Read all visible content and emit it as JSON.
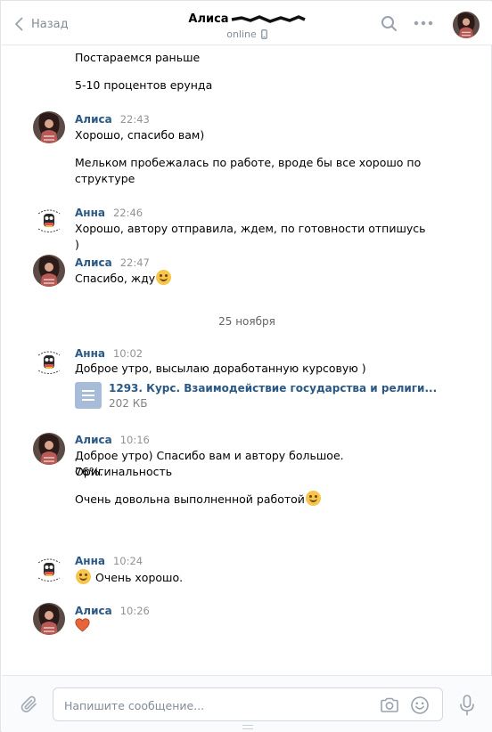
{
  "header": {
    "back_label": "Назад",
    "peer_name": "Алиса",
    "peer_status": "online",
    "icons": [
      "chevron-left-icon",
      "search-icon",
      "more-icon",
      "phone-icon"
    ]
  },
  "messages": {
    "m0": {
      "lines": [
        "Постараемся раньше"
      ]
    },
    "m1": {
      "lines": [
        "5-10 процентов ерунда"
      ]
    },
    "m2": {
      "author": "Алиса",
      "time": "22:43",
      "lines": [
        "Хорошо, спасибо вам)"
      ]
    },
    "m3": {
      "lines": [
        "Мельком пробежалась по работе, вроде бы все хорошо по",
        "структуре"
      ]
    },
    "m4": {
      "author": "Анна",
      "time": "22:46",
      "lines": [
        "Хорошо, автору отправила, ждем, по готовности отпишусь )"
      ]
    },
    "m5": {
      "author": "Алиса",
      "time": "22:47",
      "lines": [
        "Спасибо, жду"
      ]
    },
    "date_separator": "25 ноября",
    "m6": {
      "author": "Анна",
      "time": "10:02",
      "lines": [
        "Доброе утро, высылаю доработанную курсовую )"
      ]
    },
    "doc": {
      "title": "1293. Курс. Взаимодействие государства и религи...",
      "size": "202 КБ"
    },
    "m7": {
      "author": "Алиса",
      "time": "10:16",
      "lines": [
        "Доброе утро) Спасибо вам и автору большое. Оригинальность",
        "76%."
      ]
    },
    "m8": {
      "lines": [
        "Очень довольна выполненной работой"
      ]
    },
    "m9": {
      "author": "Анна",
      "time": "10:24",
      "lines": [
        "Очень хорошо."
      ]
    },
    "m10": {
      "author": "Алиса",
      "time": "10:26",
      "lines": [
        ""
      ]
    }
  },
  "composer": {
    "placeholder": "Напишите сообщение...",
    "icons": [
      "paperclip-icon",
      "camera-icon",
      "smile-icon",
      "microphone-icon"
    ]
  },
  "colors": {
    "link_blue": "#2a5885",
    "muted": "#818c99",
    "border": "#e7e8ec",
    "emoji_yellow": "#f6c549",
    "heart_red": "#e64646"
  }
}
